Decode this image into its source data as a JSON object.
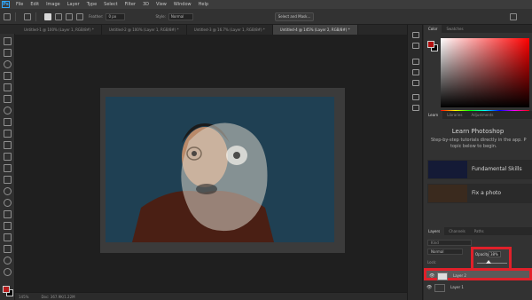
{
  "app": {
    "logo": "Ps"
  },
  "menubar": {
    "items": [
      "File",
      "Edit",
      "Image",
      "Layer",
      "Type",
      "Select",
      "Filter",
      "3D",
      "View",
      "Window",
      "Help"
    ]
  },
  "options": {
    "feather_label": "Feather:",
    "feather_value": "0 px",
    "style_label": "Style:",
    "style_value": "Normal",
    "select_mask_label": "Select and Mask..."
  },
  "tabs": [
    {
      "label": "Untitled-1 @ 100% (Layer 1, RGB/8#) *",
      "active": false
    },
    {
      "label": "Untitled-2 @ 100% (Layer 1, RGB/8#) *",
      "active": false
    },
    {
      "label": "Untitled-3 @ 16.7% (Layer 1, RGB/8#) *",
      "active": false
    },
    {
      "label": "Untitled-4 @ 145% (Layer 2, RGB/8#) *",
      "active": true
    }
  ],
  "status": {
    "zoom": "145%",
    "doc": "Doc: 367.9K/1.22M"
  },
  "color_panel": {
    "tabs": [
      "Color",
      "Swatches"
    ],
    "foreground": "#b10f0f",
    "background": "#000000"
  },
  "learn_panel": {
    "tabs": [
      "Learn",
      "Libraries",
      "Adjustments"
    ],
    "title": "Learn Photoshop",
    "description_line1": "Step-by-step tutorials directly in the app. P",
    "description_line2": "topic below to begin.",
    "cards": [
      "Fundamental Skills",
      "Fix a photo"
    ]
  },
  "layers_panel": {
    "tabs": [
      "Layers",
      "Channels",
      "Paths"
    ],
    "search_placeholder": "Kind",
    "blend_mode": "Normal",
    "lock_label": "Lock:",
    "opacity_label": "Opacity:",
    "opacity_value": "38%",
    "opacity_fraction": 0.38,
    "layers": [
      {
        "name": "Layer 2",
        "selected": true
      },
      {
        "name": "Layer 1",
        "selected": false
      }
    ]
  },
  "colors": {
    "highlight": "#e0202a",
    "canvas_bg": "#1f1f1f",
    "photo_bg": "#1d3b4c"
  }
}
